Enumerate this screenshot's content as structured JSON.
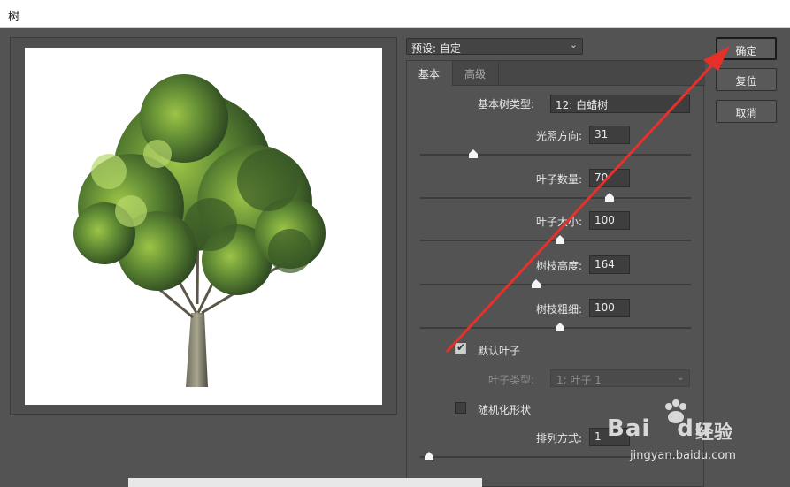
{
  "window": {
    "title": "树"
  },
  "preset": {
    "label": "预设: 自定"
  },
  "tabs": [
    {
      "label": "基本"
    },
    {
      "label": "高级"
    }
  ],
  "basic": {
    "tree_type": {
      "label": "基本树类型:",
      "value": "12: 白蜡树"
    },
    "sliders": [
      {
        "label": "光照方向:",
        "value": "31",
        "level": 0.17
      },
      {
        "label": "叶子数量:",
        "value": "70",
        "level": 0.69
      },
      {
        "label": "叶子大小:",
        "value": "100",
        "level": 0.5
      },
      {
        "label": "树枝高度:",
        "value": "164",
        "level": 0.41
      },
      {
        "label": "树枝粗细:",
        "value": "100",
        "level": 0.5
      }
    ],
    "default_leaves": {
      "label": "默认叶子",
      "checked": true
    },
    "leaf_type": {
      "label": "叶子类型:",
      "value": "1: 叶子 1",
      "disabled": true
    },
    "randomize": {
      "label": "随机化形状",
      "checked": false
    },
    "arrangement": {
      "label": "排列方式:",
      "value": "1",
      "level": 0.0
    }
  },
  "buttons": {
    "ok": "确定",
    "reset": "复位",
    "cancel": "取消"
  },
  "watermark": {
    "brand": "Bai",
    "brand2": "du",
    "cn": "经验",
    "url": "jingyan.baidu.com"
  },
  "annotation": {
    "color": "#e8302a"
  },
  "colors": {
    "dialog_bg": "#535353",
    "preview_bg": "#ffffff"
  }
}
